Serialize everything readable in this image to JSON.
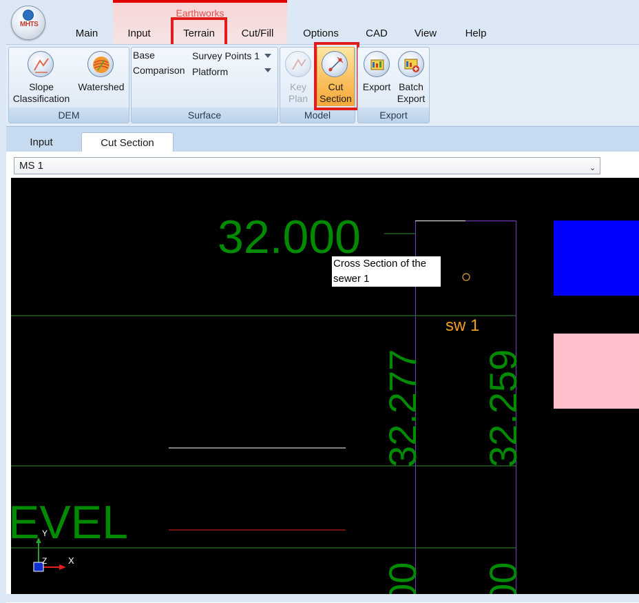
{
  "app": {
    "logo_text": "MHTS",
    "context_group": "Earthworks"
  },
  "menu": {
    "tabs": [
      "Main",
      "Input",
      "Terrain",
      "Cut/Fill",
      "Options",
      "CAD",
      "View",
      "Help"
    ],
    "highlighted_tab": "Terrain"
  },
  "ribbon": {
    "dem": {
      "label": "DEM",
      "slope_line1": "Slope",
      "slope_line2": "Classification",
      "watershed": "Watershed"
    },
    "surface": {
      "label": "Surface",
      "base_label": "Base",
      "base_value": "Survey Points 1",
      "comparison_label": "Comparison",
      "comparison_value": "Platform"
    },
    "model": {
      "label": "Model",
      "keyplan_line1": "Key",
      "keyplan_line2": "Plan",
      "cut_line1": "Cut",
      "cut_line2": "Section"
    },
    "export": {
      "label": "Export",
      "export": "Export",
      "batch_line1": "Batch",
      "batch_line2": "Export"
    }
  },
  "document": {
    "tabs": [
      "Input",
      "Cut Section"
    ],
    "active_tab": "Cut Section",
    "section_select": "MS 1"
  },
  "canvas": {
    "level_value": "32.000",
    "level_word": "EVEL",
    "vertical_label_left": "32.277",
    "vertical_label_right": "32.259",
    "vertical_bottom_left": "00",
    "vertical_bottom_right": "00",
    "sewer_tag": "sw 1",
    "tooltip_line1": "Cross Section of the",
    "tooltip_line2": "sewer 1",
    "axis_y": "Y",
    "axis_z": "Z",
    "axis_x": "X"
  },
  "colors": {
    "accent_highlight": "#e21b1b",
    "cad_text_green": "#008a00",
    "sewer_label": "#f0a020",
    "blue_block": "#0000ff",
    "pink_block": "#ffc0cb"
  }
}
